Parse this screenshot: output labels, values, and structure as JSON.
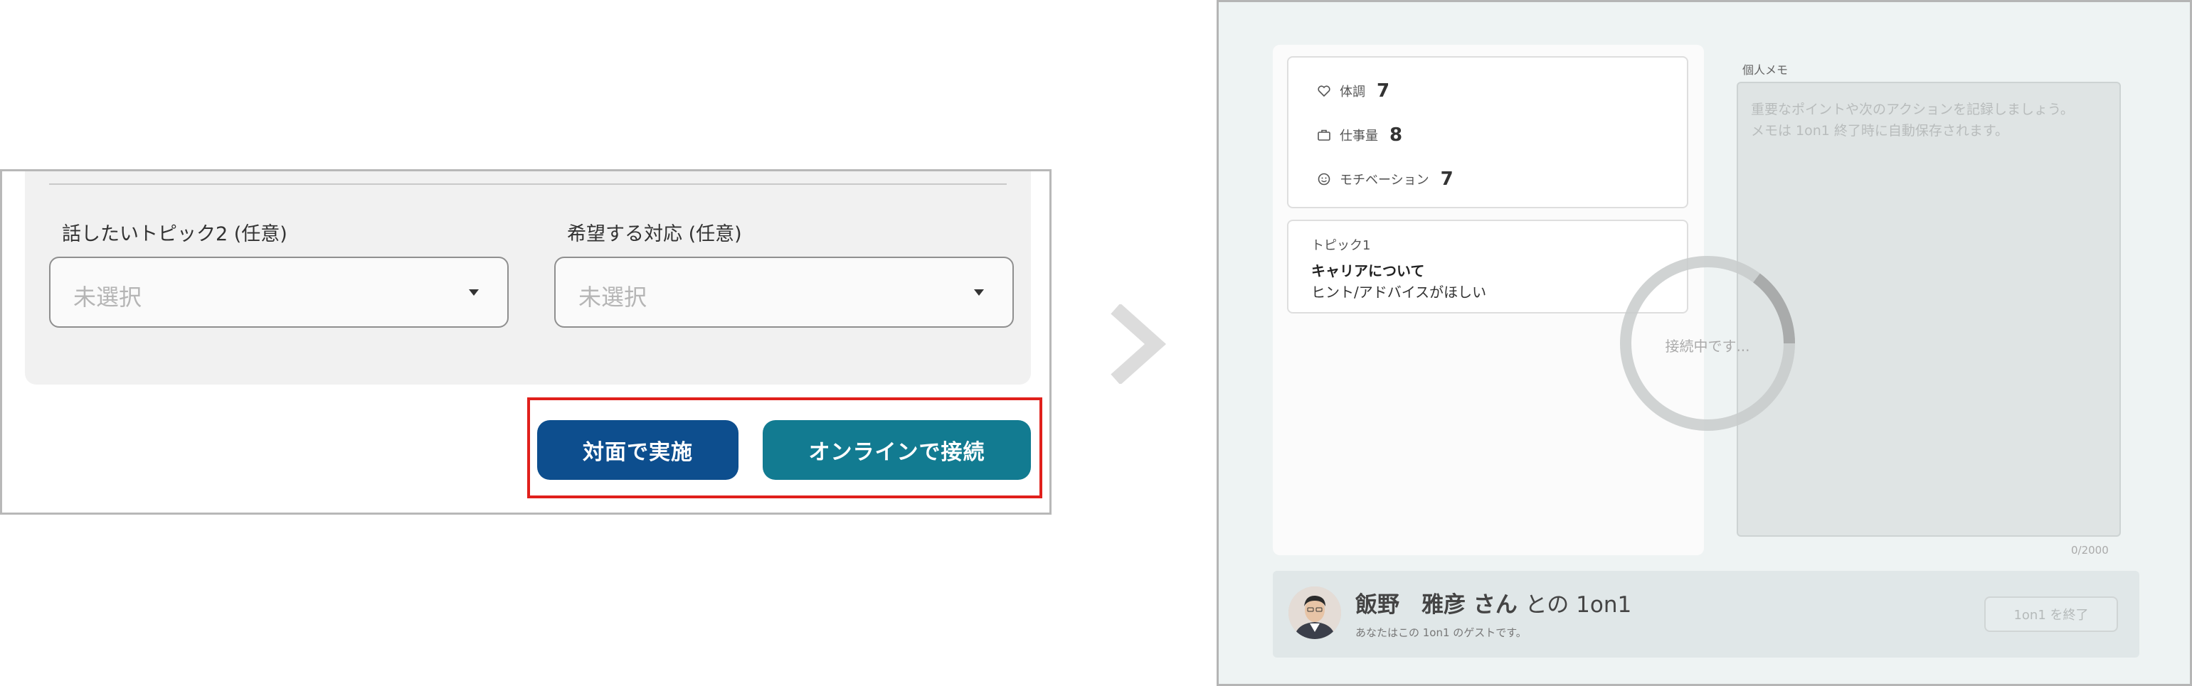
{
  "left": {
    "topic2_label": "話したいトピック2 (任意)",
    "topic2_placeholder": "未選択",
    "response_label": "希望する対応 (任意)",
    "response_placeholder": "未選択",
    "face_button": "対面で実施",
    "online_button": "オンラインで接続"
  },
  "right": {
    "stats": [
      {
        "label": "体調",
        "value": "7",
        "icon": "heart-icon"
      },
      {
        "label": "仕事量",
        "value": "8",
        "icon": "briefcase-icon"
      },
      {
        "label": "モチベーション",
        "value": "7",
        "icon": "smile-icon"
      }
    ],
    "topic": {
      "label": "トピック1",
      "title": "キャリアについて",
      "request": "ヒント/アドバイスがほしい"
    },
    "memo": {
      "label": "個人メモ",
      "placeholder_line1": "重要なポイントや次のアクションを記録しましょう。",
      "placeholder_line2": "メモは 1on1 終了時に自動保存されます。",
      "counter": "0/2000"
    },
    "loading_text": "接続中です...",
    "guest": {
      "name": "飯野　雅彦 さん",
      "suffix": "との 1on1",
      "subtitle": "あなたはこの 1on1 のゲストです。"
    },
    "end_button": "1on1 を終了"
  },
  "colors": {
    "face_button": "#0d4e8e",
    "online_button": "#127b91",
    "highlight": "#e0201c"
  }
}
